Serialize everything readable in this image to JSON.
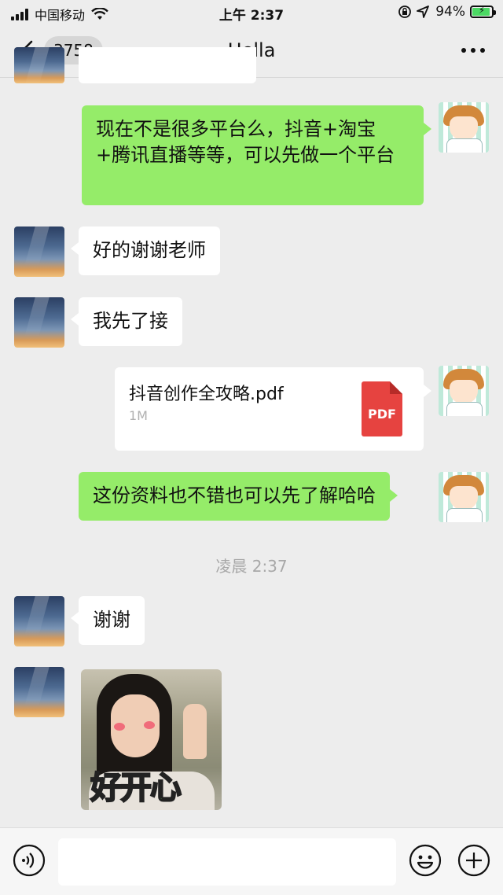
{
  "status_bar": {
    "carrier": "中国移动",
    "time": "上午 2:37",
    "battery_percent": "94%",
    "battery_level": 0.94,
    "icons": [
      "signal-icon",
      "wifi-icon",
      "rotation-lock-icon",
      "location-icon",
      "battery-charging-icon"
    ]
  },
  "nav": {
    "back_icon": "chevron-left-icon",
    "unread_count": "3758",
    "title": "Hella",
    "more_icon": "more-dots-icon"
  },
  "messages": [
    {
      "side": "right",
      "type": "text",
      "text": "现在不是很多平台么，抖音+淘宝+腾讯直播等等，可以先做一个平台"
    },
    {
      "side": "left",
      "type": "text",
      "text": "好的谢谢老师"
    },
    {
      "side": "left",
      "type": "text",
      "text": "我先了接"
    },
    {
      "side": "right",
      "type": "file",
      "file_name": "抖音创作全攻略.pdf",
      "file_size": "1M",
      "file_badge": "PDF",
      "file_color": "#e64340"
    },
    {
      "side": "right",
      "type": "text",
      "text": "这份资料也不错也可以先了解哈哈"
    },
    {
      "type": "timestamp",
      "text": "凌晨 2:37"
    },
    {
      "side": "left",
      "type": "text",
      "text": "谢谢"
    },
    {
      "side": "left",
      "type": "sticker",
      "caption_parts": [
        "好",
        "开",
        "心"
      ]
    }
  ],
  "input_bar": {
    "voice_icon": "voice-icon",
    "text_value": "",
    "emoji_icon": "emoji-icon",
    "plus_icon": "plus-circle-icon"
  },
  "colors": {
    "background": "#ededed",
    "bubble_self": "#95ec69",
    "bubble_other": "#ffffff",
    "timestamp": "#a8a8a8"
  }
}
